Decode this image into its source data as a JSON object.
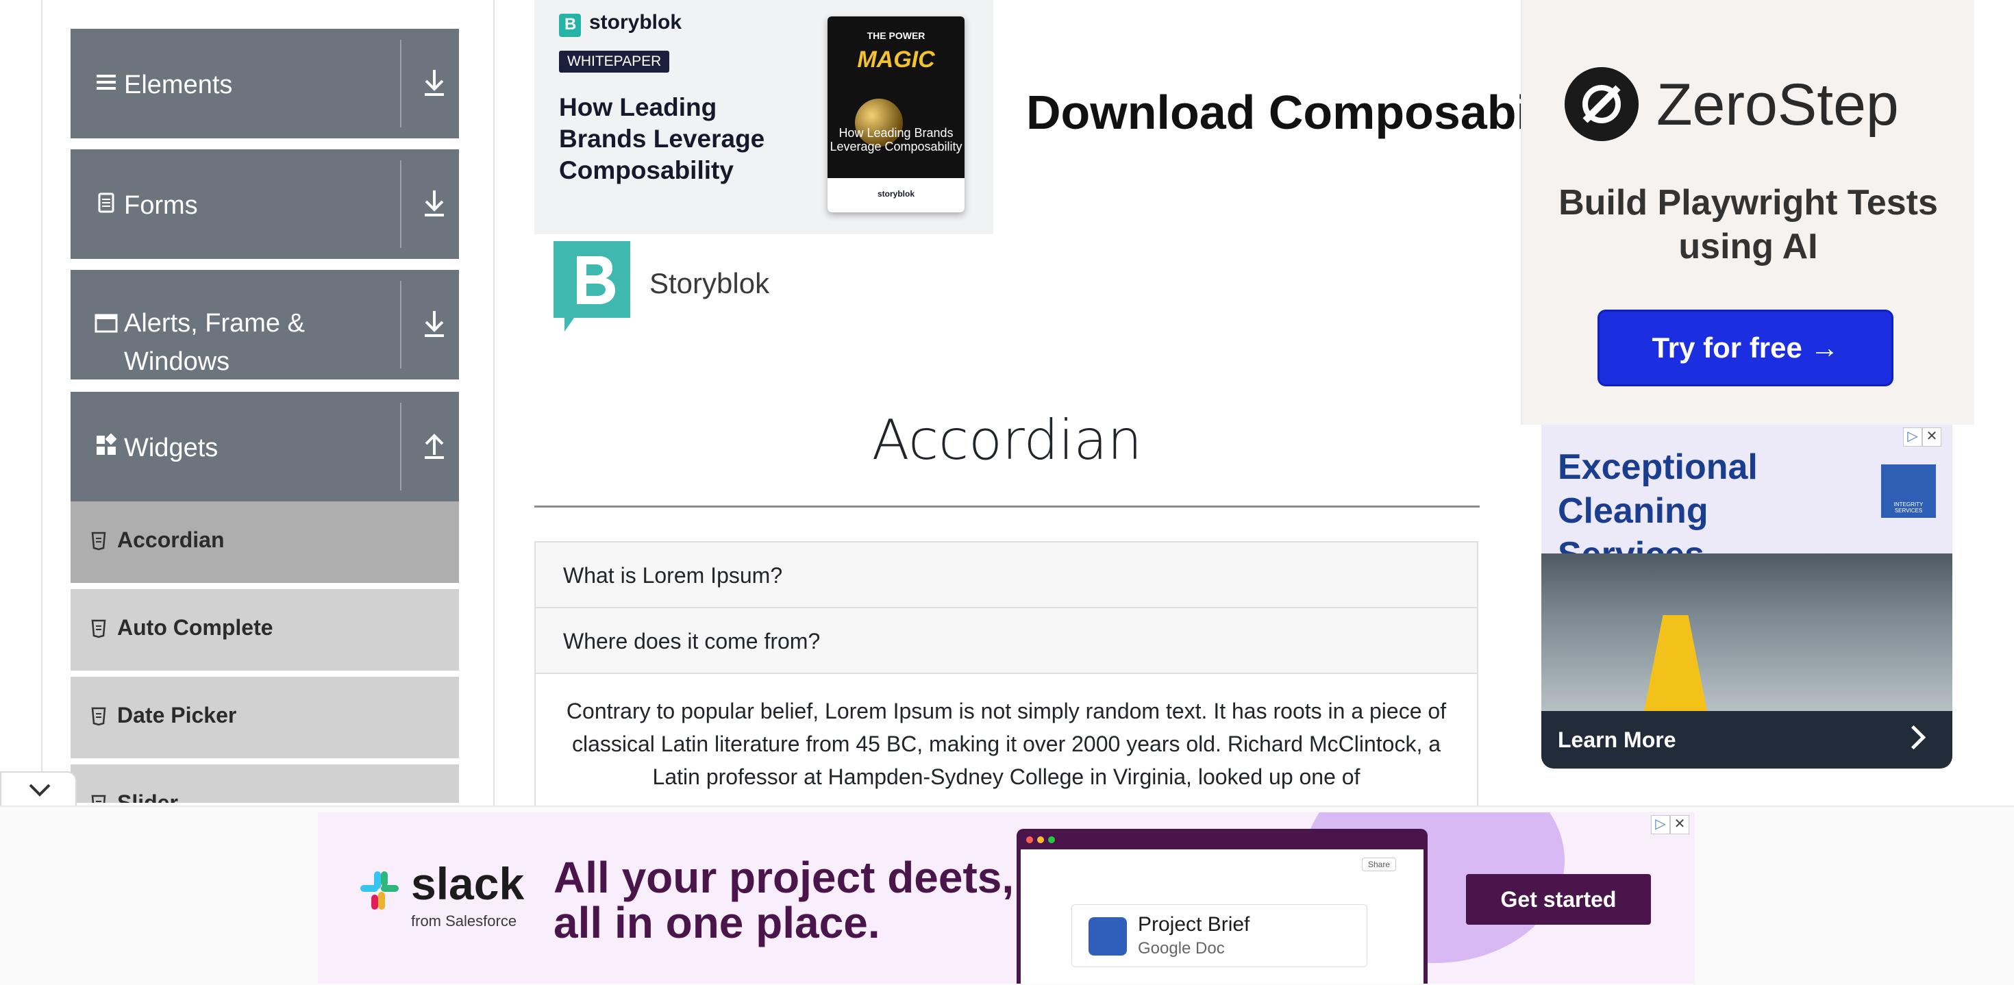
{
  "sidebar": {
    "groups": [
      {
        "label": "Elements",
        "icon": "hamburger-icon",
        "toggle": "download-icon"
      },
      {
        "label": "Forms",
        "icon": "document-icon",
        "toggle": "download-icon"
      },
      {
        "label": "Alerts, Frame &",
        "label2": "Windows",
        "icon": "window-icon",
        "toggle": "download-icon"
      },
      {
        "label": "Widgets",
        "icon": "widgets-icon",
        "toggle": "upload-icon"
      }
    ],
    "items": [
      {
        "label": "Accordian",
        "active": true
      },
      {
        "label": "Auto Complete"
      },
      {
        "label": "Date Picker"
      },
      {
        "label": "Slider"
      }
    ]
  },
  "top_ad": {
    "brand": "storyblok",
    "badge": "WHITEPAPER",
    "headline": "How Leading Brands Leverage Composability",
    "book_top": "THE POWER",
    "book_magic": "MAGIC",
    "book_title": "How Leading Brands Leverage Composability",
    "book_footer": "storyblok",
    "cta_big": "Download Composabil"
  },
  "storyblok_logo": {
    "name": "Storyblok"
  },
  "main": {
    "title": "Accordian",
    "sections": [
      {
        "heading": "What is Lorem Ipsum?"
      },
      {
        "heading": "Where does it come from?"
      }
    ],
    "body": "Contrary to popular belief, Lorem Ipsum is not simply random text. It has roots in a piece of classical Latin literature from 45 BC, making it over 2000 years old. Richard McClintock, a Latin professor at Hampden-Sydney College in Virginia, looked up one of"
  },
  "right_ad_top": {
    "brand": "ZeroStep",
    "tagline": "Build Playwright Tests using AI",
    "button": "Try for free →"
  },
  "right_ad_bottom": {
    "title": "Exceptional Cleaning Services",
    "logo_text": "INTEGRITY SERVICES",
    "cta": "Learn More"
  },
  "bottom_ad": {
    "brand": "slack",
    "brand_sub": "from Salesforce",
    "headline": "All your project deets, all in one place.",
    "share": "Share",
    "doc_title": "Project Brief",
    "doc_sub": "Google Doc",
    "cta": "Get started"
  },
  "colors": {
    "sidebar_group": "#6c757d",
    "sidebar_item": "#d1d1d1",
    "sidebar_item_active": "#aeaeae",
    "zerostep_button": "#1c2fe0",
    "slack_purple": "#4a154b"
  }
}
